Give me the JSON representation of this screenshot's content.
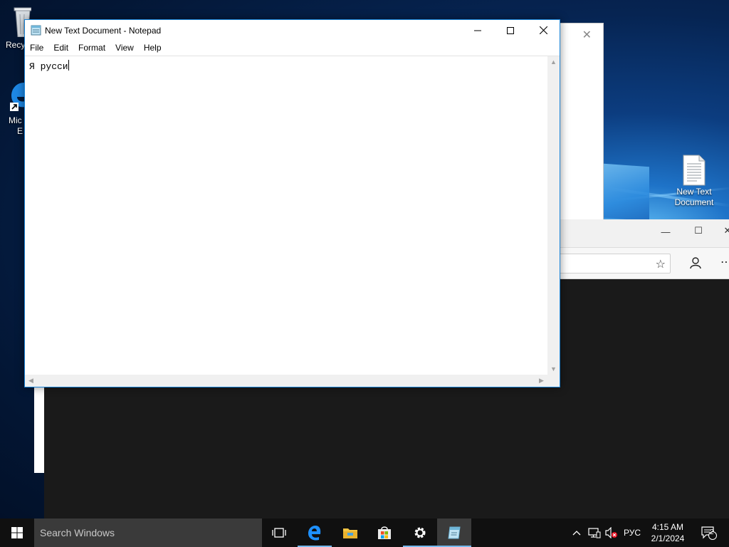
{
  "desktop": {
    "icons": [
      {
        "label": "Recy"
      },
      {
        "label": "Mic",
        "label2": "E"
      },
      {
        "label": "New Text",
        "label2": "Document"
      }
    ]
  },
  "notepad": {
    "title": "New Text Document - Notepad",
    "menu": [
      "File",
      "Edit",
      "Format",
      "View",
      "Help"
    ],
    "content": "Я русси"
  },
  "taskbar": {
    "search_placeholder": "Search Windows",
    "language": "РУС",
    "time": "4:15 AM",
    "date": "2/1/2024",
    "notification_count": "2"
  },
  "colors": {
    "accent": "#1883d7",
    "taskbar": "#101010",
    "active_indicator": "#76b9ed"
  }
}
